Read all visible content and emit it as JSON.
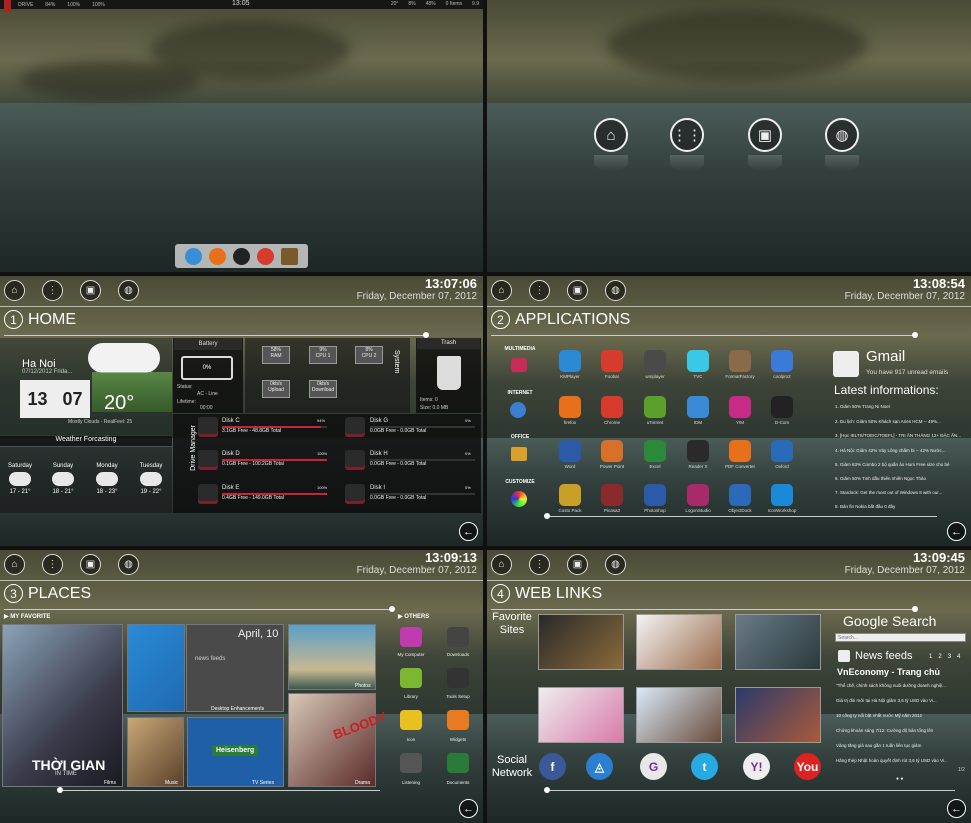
{
  "colors": {
    "accent_red": "#c2243a",
    "sky": "#6b6a4e",
    "sea": "#33403d"
  },
  "desktop": {
    "topbar": {
      "items": [
        "DRIVE",
        "84%",
        "100%",
        "100%"
      ],
      "time": "13:05",
      "right": [
        "20°",
        "8%",
        "48%",
        "0 Items",
        "9.9"
      ]
    },
    "dock_icons": [
      "itunes-icon",
      "firefox-icon",
      "alien-icon",
      "chrome-icon",
      "folder-icon"
    ]
  },
  "launcher": {
    "icons": [
      "home-icon",
      "apps-icon",
      "places-icon",
      "globe-icon"
    ]
  },
  "home": {
    "clock": "13:07:06",
    "date": "Friday, December 07, 2012",
    "title": "HOME",
    "number": "1",
    "weather": {
      "city": "Ha Noi",
      "date_line": "07/12/2012 Frida...",
      "hour": "13",
      "minute": "07",
      "temp": "20°",
      "desc": "Mostly Clouds - RealFeel: 25",
      "header": "Weather Forcasting",
      "days": [
        {
          "name": "Saturday",
          "range": "17 - 21°"
        },
        {
          "name": "Sunday",
          "range": "18 - 21°"
        },
        {
          "name": "Monday",
          "range": "18 - 23°"
        },
        {
          "name": "Tuesday",
          "range": "19 - 22°"
        }
      ]
    },
    "battery": {
      "header": "Battery",
      "pct": "0%",
      "status_label": "Status:",
      "status": "AC - Line",
      "lifetime_label": "Lifetime:",
      "lifetime": "00:00"
    },
    "system": {
      "label": "System",
      "tiles": [
        {
          "value": "58%",
          "name": "RAM"
        },
        {
          "value": "9%",
          "name": "CPU 1"
        },
        {
          "value": "8%",
          "name": "CPU 2"
        },
        {
          "value": "0kb/s",
          "name": "Upload"
        },
        {
          "value": "0kb/s",
          "name": "Download"
        }
      ]
    },
    "trash": {
      "header": "Trash",
      "items": "Items: 0",
      "size": "Size: 0.0 MB"
    },
    "drive_manager": {
      "label": "Drive Manager",
      "disks": [
        {
          "name": "Disk C",
          "free": "3.1GB Free - 48.8GB Total",
          "pct": "94%",
          "fill": 0.94
        },
        {
          "name": "Disk G",
          "free": "0.0GB Free - 0.0GB Total",
          "pct": "0%",
          "fill": 0
        },
        {
          "name": "Disk D",
          "free": "0.1GB Free - 100.2GB Total",
          "pct": "100%",
          "fill": 1.0
        },
        {
          "name": "Disk H",
          "free": "0.0GB Free - 0.0GB Total",
          "pct": "0%",
          "fill": 0
        },
        {
          "name": "Disk E",
          "free": "0.4GB Free - 149.0GB Total",
          "pct": "100%",
          "fill": 1.0
        },
        {
          "name": "Disk I",
          "free": "0.0GB Free - 0.0GB Total",
          "pct": "0%",
          "fill": 0
        }
      ]
    }
  },
  "applications": {
    "clock": "13:08:54",
    "date": "Friday, December 07, 2012",
    "title": "APPLICATIONS",
    "number": "2",
    "categories": [
      "MULTIMEDIA",
      "INTERNET",
      "OFFICE",
      "CUSTOMIZE"
    ],
    "rows": [
      [
        "KMPlayer",
        "Foobar",
        "wmplayer",
        "TVC",
        "FormatFactory",
        "coolpro2"
      ],
      [
        "firefox",
        "Chrome",
        "uTorrent",
        "IDM",
        "Y!M",
        "D-Com"
      ],
      [
        "Word",
        "Power Point",
        "Excel",
        "Reader X",
        "PDF Converter",
        "Oxford"
      ],
      [
        "Custo Pack",
        "Picasa3",
        "Photoshop",
        "LogonStudio",
        "ObjectDock",
        "IconWorkshop"
      ]
    ],
    "gmail": {
      "title": "Gmail",
      "unread": "You have 917 unread emails"
    },
    "latest": {
      "header": "Latest informations:",
      "items": [
        "1. Giảm 50% Trang Ni Noel",
        "2. Du lịch: Giảm 50% Khách sạn Aries HCM -- 49%...",
        "3. [Học IELTS/TOEIC/TOEFL] - TRI ÂN THÁNG 12+ ĐẶC ẤN...",
        "4. Hà Nội: Giảm 42% Váy Lông chấm bi -- 42% Nước...",
        "5. Giảm 63% Combo 2 bộ quần áo Hum Free size cho bé",
        "6. Giảm 50% Tinh dầu thiên nhiên Ngọc Thảo",
        "7. Stardock: Get the most out of Windows 8 with our...",
        "8. Bán fin Nokia bất đầu 0 đây"
      ]
    }
  },
  "places": {
    "clock": "13:09:13",
    "date": "Friday, December 07, 2012",
    "title": "PLACES",
    "number": "3",
    "my_favorite": "MY FAVORITE",
    "others": "OTHERS",
    "films_text": "THỜI GIAN",
    "films_sub": "IN TIME",
    "heisenberg": "Heisenberg",
    "drama_text": "BLOODY",
    "calendar": "April, 10",
    "news": "news feeds",
    "labels": [
      "Films",
      "Music",
      "TV Series",
      "Desktop Enhancements",
      "Photos",
      "Drama"
    ],
    "other_items": [
      "My Computer",
      "Downloads",
      "Library",
      "Tools Setup",
      "Icon",
      "Widgets",
      "Listening",
      "Documents"
    ]
  },
  "weblinks": {
    "clock": "13:09:45",
    "date": "Friday, December 07, 2012",
    "title": "WEB LINKS",
    "number": "4",
    "favorite": "Favorite Sites",
    "social": "Social Network",
    "search": {
      "title": "Google Search",
      "placeholder": "Search..."
    },
    "news": {
      "header": "News feeds",
      "pages": [
        "1",
        "2",
        "3",
        "4"
      ],
      "source": "VnEconomy - Trang chủ",
      "page_counter": "1/2",
      "items": [
        "\"Thể chế, chính sách không nuôi dưỡng doanh nghiệ...",
        "Giá trị đòi mới tại Hà Nội giảm 3,6 tỷ USD vào Vi...",
        "10 công ty nổi bật nhất nước Mỹ năm 2012",
        "Chứng khoán sáng 7/12: Cường độ bán tổng lên",
        "Vàng tăng giá sau gần 1 tuần liên tục giảm",
        "Hãng thép Nhật hoàn quyết định rút 3,6 tỷ USD vào Vi..."
      ]
    },
    "socials": [
      {
        "icon": "facebook-icon",
        "glyph": "f",
        "color": "#3b5998"
      },
      {
        "icon": "delicious-icon",
        "glyph": "◬",
        "color": "#2a7fd0"
      },
      {
        "icon": "google-icon",
        "glyph": "G",
        "color": "#e8e8e8"
      },
      {
        "icon": "twitter-icon",
        "glyph": "t",
        "color": "#27a9e1"
      },
      {
        "icon": "yahoo-icon",
        "glyph": "Y!",
        "color": "#eee"
      },
      {
        "icon": "youtube-icon",
        "glyph": "You",
        "color": "#d22"
      }
    ]
  }
}
